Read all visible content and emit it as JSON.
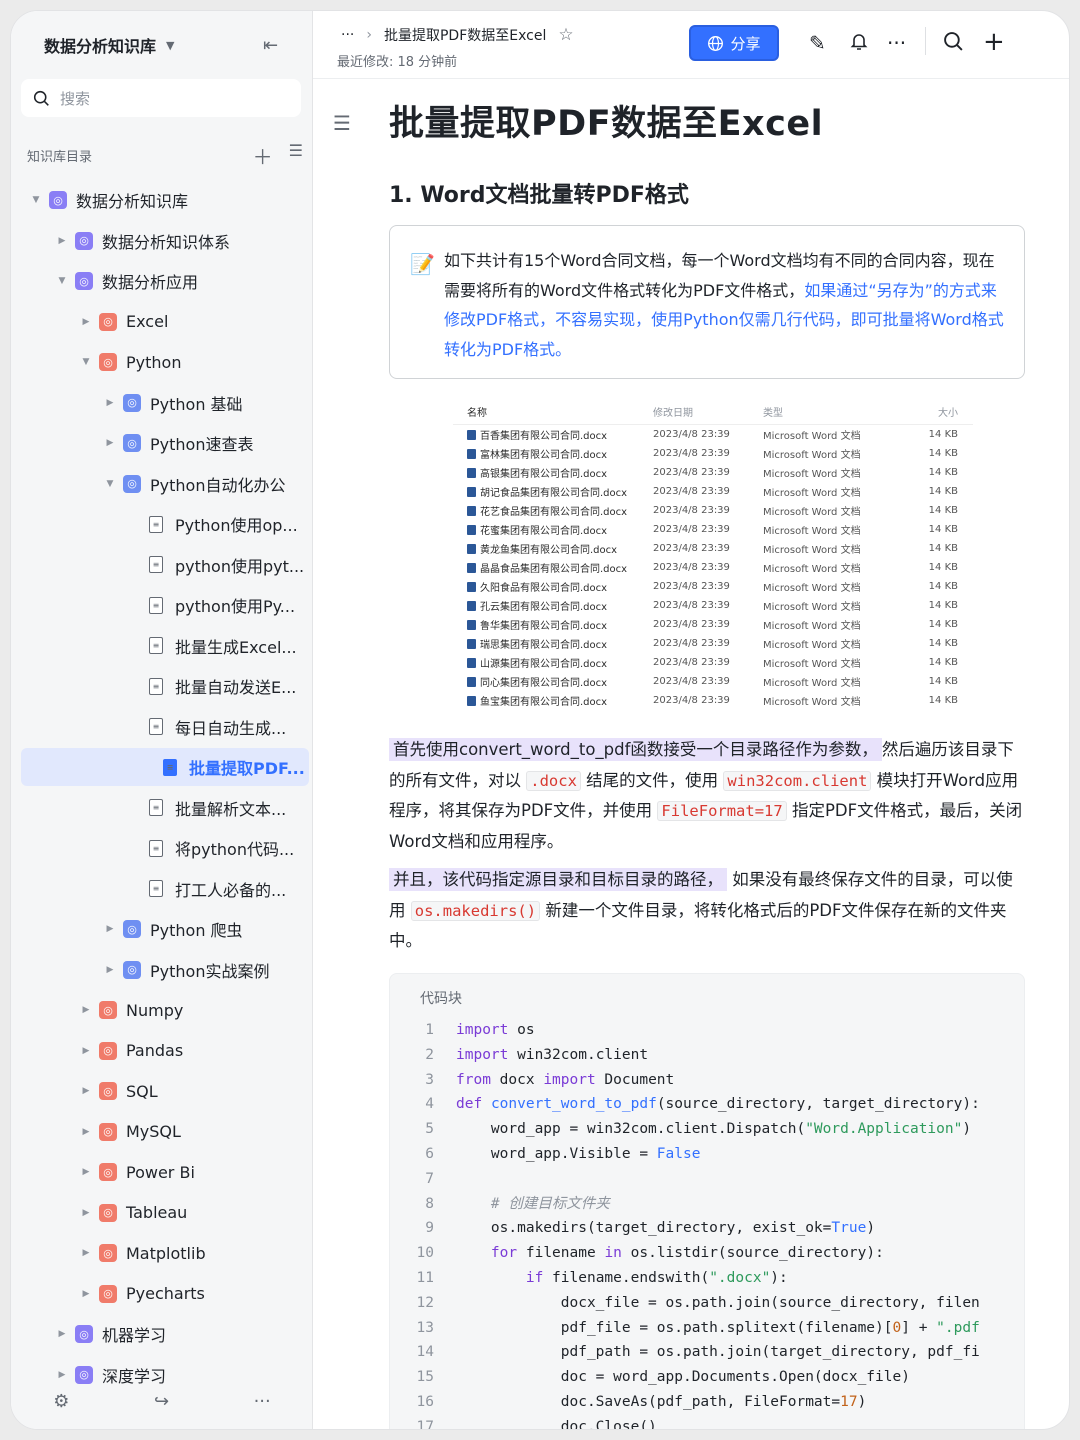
{
  "sidebar": {
    "kb_title": "数据分析知识库",
    "search_placeholder": "搜索",
    "dir_label": "知识库目录",
    "items": [
      {
        "label": "数据分析知识库",
        "level": 0,
        "icon": "purple",
        "caret": "down"
      },
      {
        "label": "数据分析知识体系",
        "level": 1,
        "icon": "purple",
        "caret": "right"
      },
      {
        "label": "数据分析应用",
        "level": 1,
        "icon": "purple",
        "caret": "down"
      },
      {
        "label": "Excel",
        "level": 2,
        "icon": "red",
        "caret": "right"
      },
      {
        "label": "Python",
        "level": 2,
        "icon": "red",
        "caret": "down"
      },
      {
        "label": "Python 基础",
        "level": 3,
        "icon": "blue",
        "caret": "right"
      },
      {
        "label": "Python速查表",
        "level": 3,
        "icon": "blue",
        "caret": "right"
      },
      {
        "label": "Python自动化办公",
        "level": 3,
        "icon": "blue",
        "caret": "down"
      },
      {
        "label": "Python使用op...",
        "level": 4,
        "icon": "doc",
        "caret": ""
      },
      {
        "label": "python使用pyt...",
        "level": 4,
        "icon": "doc",
        "caret": ""
      },
      {
        "label": "python使用Py...",
        "level": 4,
        "icon": "doc",
        "caret": ""
      },
      {
        "label": "批量生成Excel...",
        "level": 4,
        "icon": "doc",
        "caret": ""
      },
      {
        "label": "批量自动发送E...",
        "level": 4,
        "icon": "doc",
        "caret": ""
      },
      {
        "label": "每日自动生成...",
        "level": 4,
        "icon": "doc",
        "caret": ""
      },
      {
        "label": "批量提取PDF...",
        "level": 4,
        "icon": "doc",
        "caret": "",
        "active": true
      },
      {
        "label": "批量解析文本...",
        "level": 4,
        "icon": "doc",
        "caret": ""
      },
      {
        "label": "将python代码...",
        "level": 4,
        "icon": "doc",
        "caret": ""
      },
      {
        "label": "打工人必备的...",
        "level": 4,
        "icon": "doc",
        "caret": ""
      },
      {
        "label": "Python 爬虫",
        "level": 3,
        "icon": "blue",
        "caret": "right"
      },
      {
        "label": "Python实战案例",
        "level": 3,
        "icon": "blue",
        "caret": "right"
      },
      {
        "label": "Numpy",
        "level": 2,
        "icon": "red",
        "caret": "right"
      },
      {
        "label": "Pandas",
        "level": 2,
        "icon": "red",
        "caret": "right"
      },
      {
        "label": "SQL",
        "level": 2,
        "icon": "red",
        "caret": "right"
      },
      {
        "label": "MySQL",
        "level": 2,
        "icon": "red",
        "caret": "right"
      },
      {
        "label": "Power Bi",
        "level": 2,
        "icon": "red",
        "caret": "right"
      },
      {
        "label": "Tableau",
        "level": 2,
        "icon": "red",
        "caret": "right"
      },
      {
        "label": "Matplotlib",
        "level": 2,
        "icon": "red",
        "caret": "right"
      },
      {
        "label": "Pyecharts",
        "level": 2,
        "icon": "red",
        "caret": "right"
      },
      {
        "label": "机器学习",
        "level": 1,
        "icon": "purple",
        "caret": "right"
      },
      {
        "label": "深度学习",
        "level": 1,
        "icon": "purple",
        "caret": "right"
      }
    ]
  },
  "topbar": {
    "ellipsis": "···",
    "breadcrumb": "批量提取PDF数据至Excel",
    "modified": "最近修改: 18 分钟前",
    "share_label": "分享"
  },
  "doc": {
    "title": "批量提取PDF数据至Excel",
    "h2": "1. Word文档批量转PDF格式",
    "callout_text": "如下共计有15个Word合同文档，每一个Word文档均有不同的合同内容，现在需要将所有的Word文件格式转化为PDF文件格式，",
    "callout_blue": "如果通过“另存为”的方式来修改PDF格式，不容易实现，使用Python仅需几行代码，即可批量将Word格式转化为PDF格式。",
    "file_headers": [
      "名称",
      "修改日期",
      "类型",
      "大小"
    ],
    "files": [
      "百香集团有限公司合同.docx",
      "富林集团有限公司合同.docx",
      "高银集团有限公司合同.docx",
      "胡记食品集团有限公司合同.docx",
      "花艺食品集团有限公司合同.docx",
      "花蜜集团有限公司合同.docx",
      "黄龙鱼集团有限公司合同.docx",
      "晶晶食品集团有限公司合同.docx",
      "久阳食品有限公司合同.docx",
      "孔云集团有限公司合同.docx",
      "鲁华集团有限公司合同.docx",
      "瑞思集团有限公司合同.docx",
      "山源集团有限公司合同.docx",
      "同心集团有限公司合同.docx",
      "鱼宝集团有限公司合同.docx"
    ],
    "file_date": "2023/4/8 23:39",
    "file_type": "Microsoft Word 文档",
    "file_size": "14 KB",
    "p1_hl": "首先使用convert_word_to_pdf函数接受一个目录路径作为参数，",
    "p1_a": "然后遍历该目录下的所有文件，对以",
    "p1_code1": ".docx",
    "p1_b": "结尾的文件，使用",
    "p1_code2": "win32com.client",
    "p1_c": "模块打开Word应用程序，将其保存为PDF文件，并使用",
    "p1_code3": "FileFormat=17",
    "p1_d": "指定PDF文件格式，最后，关闭Word文档和应用程序。",
    "p2_hl": "并且，该代码指定源目录和目标目录的路径，",
    "p2_a": "如果没有最终保存文件的目录，可以使用",
    "p2_code": "os.makedirs()",
    "p2_b": "新建一个文件目录，将转化格式后的PDF文件保存在新的文件夹中。",
    "code_label": "代码块"
  }
}
